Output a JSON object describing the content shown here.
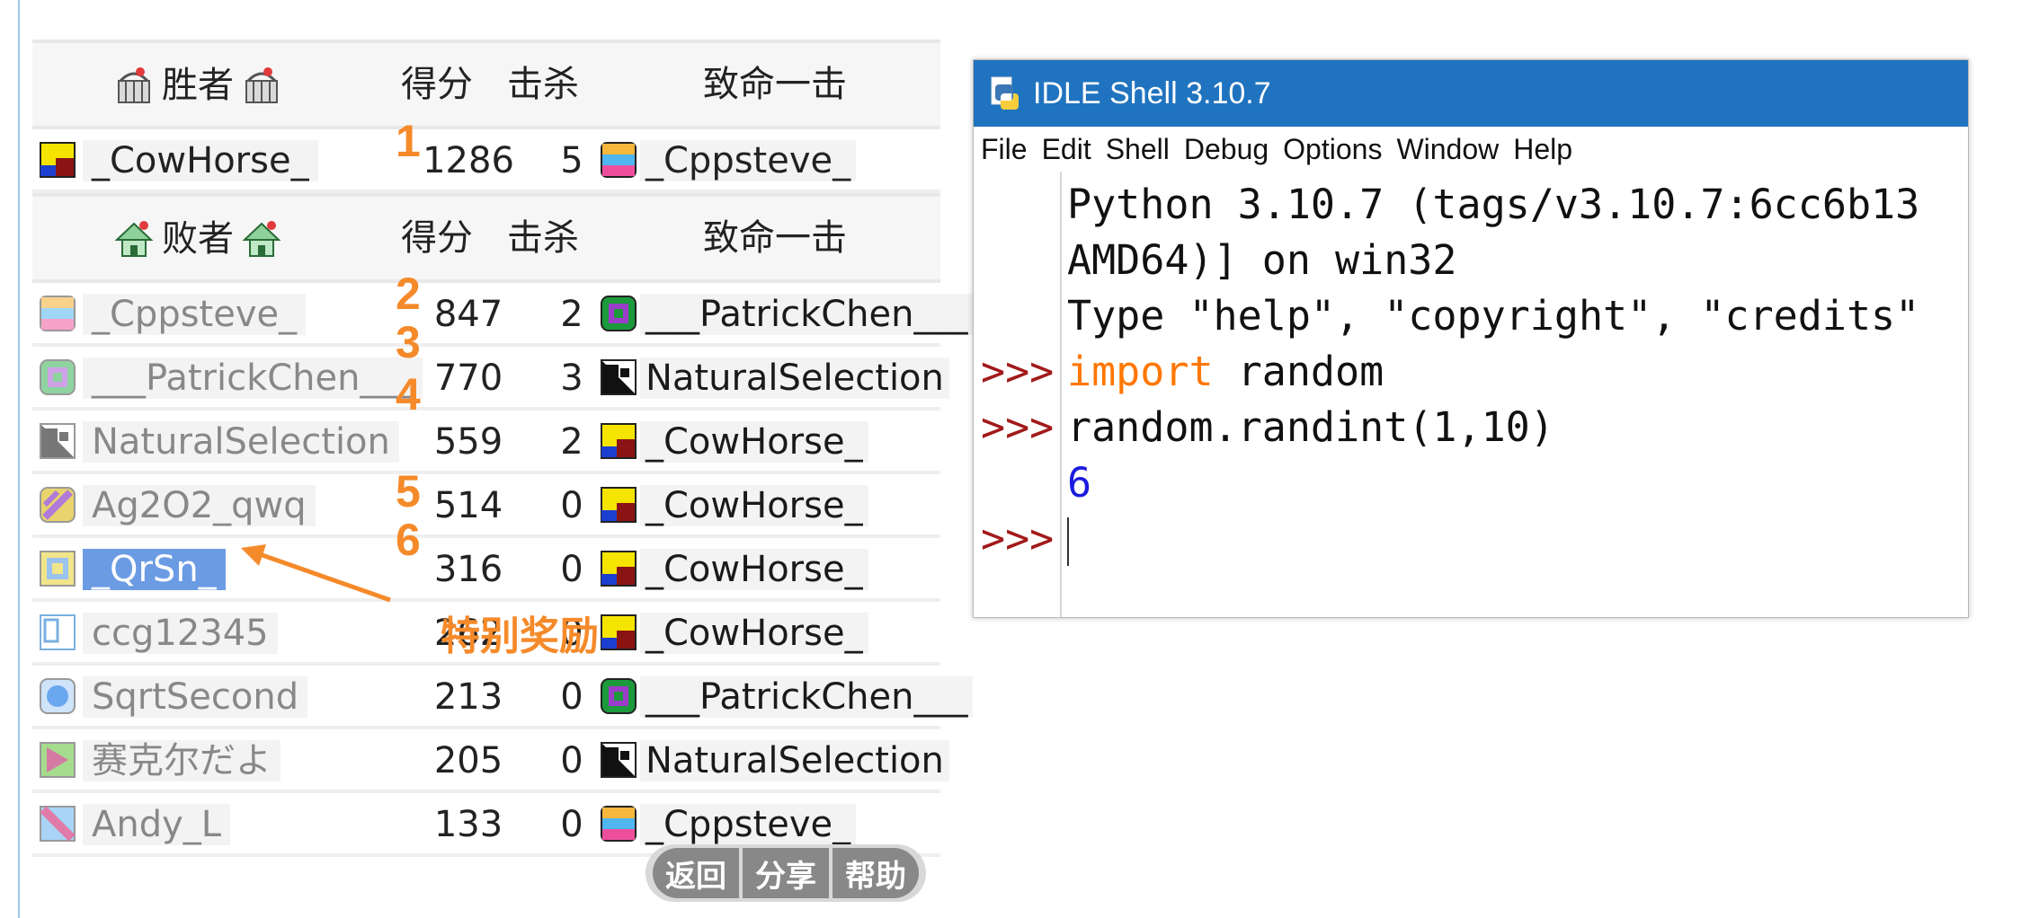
{
  "board": {
    "winner_header": {
      "title": "胜者",
      "score": "得分",
      "kills": "击杀",
      "finisher": "致命一击"
    },
    "winner": {
      "name": "_CowHorse_",
      "score": "1286",
      "kills": "5",
      "finisher": "_Cppsteve_"
    },
    "loser_header": {
      "title": "败者",
      "score": "得分",
      "kills": "击杀",
      "finisher": "致命一击"
    },
    "losers": [
      {
        "name": "_Cppsteve_",
        "score": "847",
        "kills": "2",
        "finisher": "___PatrickChen___"
      },
      {
        "name": "___PatrickChen___",
        "score": "770",
        "kills": "3",
        "finisher": "NaturalSelection"
      },
      {
        "name": "NaturalSelection",
        "score": "559",
        "kills": "2",
        "finisher": "_CowHorse_"
      },
      {
        "name": "Ag2O2_qwq",
        "score": "514",
        "kills": "0",
        "finisher": "_CowHorse_"
      },
      {
        "name": "_QrSn_",
        "score": "316",
        "kills": "0",
        "finisher": "_CowHorse_"
      },
      {
        "name": "ccg12345",
        "score": "262",
        "kills": "0",
        "finisher": "_CowHorse_"
      },
      {
        "name": "SqrtSecond",
        "score": "213",
        "kills": "0",
        "finisher": "___PatrickChen___"
      },
      {
        "name": "赛克尔だよ",
        "score": "205",
        "kills": "0",
        "finisher": "NaturalSelection"
      },
      {
        "name": "Andy_L",
        "score": "133",
        "kills": "0",
        "finisher": "_Cppsteve_"
      }
    ],
    "ranks": [
      "1",
      "2",
      "3",
      "4",
      "5",
      "6"
    ],
    "annotation": "特别奖励",
    "buttons": {
      "back": "返回",
      "share": "分享",
      "help": "帮助"
    },
    "colors": {
      "rank": "#f58a2a",
      "selection": "#6b9be3"
    }
  },
  "idle": {
    "title": "IDLE Shell 3.10.7",
    "menu": [
      "File",
      "Edit",
      "Shell",
      "Debug",
      "Options",
      "Window",
      "Help"
    ],
    "lines": {
      "l1": "Python 3.10.7 (tags/v3.10.7:6cc6b13",
      "l2": "AMD64)] on win32",
      "l3": "Type \"help\", \"copyright\", \"credits\"",
      "l4_kw": "import",
      "l4_rest": " random",
      "l5": "random.randint(1,10)",
      "l6": "6"
    },
    "prompt": ">>>",
    "colors": {
      "titlebar": "#1f73bf",
      "prompt": "#a21a1a",
      "keyword": "#ff7700",
      "output": "#1b1bde"
    }
  }
}
